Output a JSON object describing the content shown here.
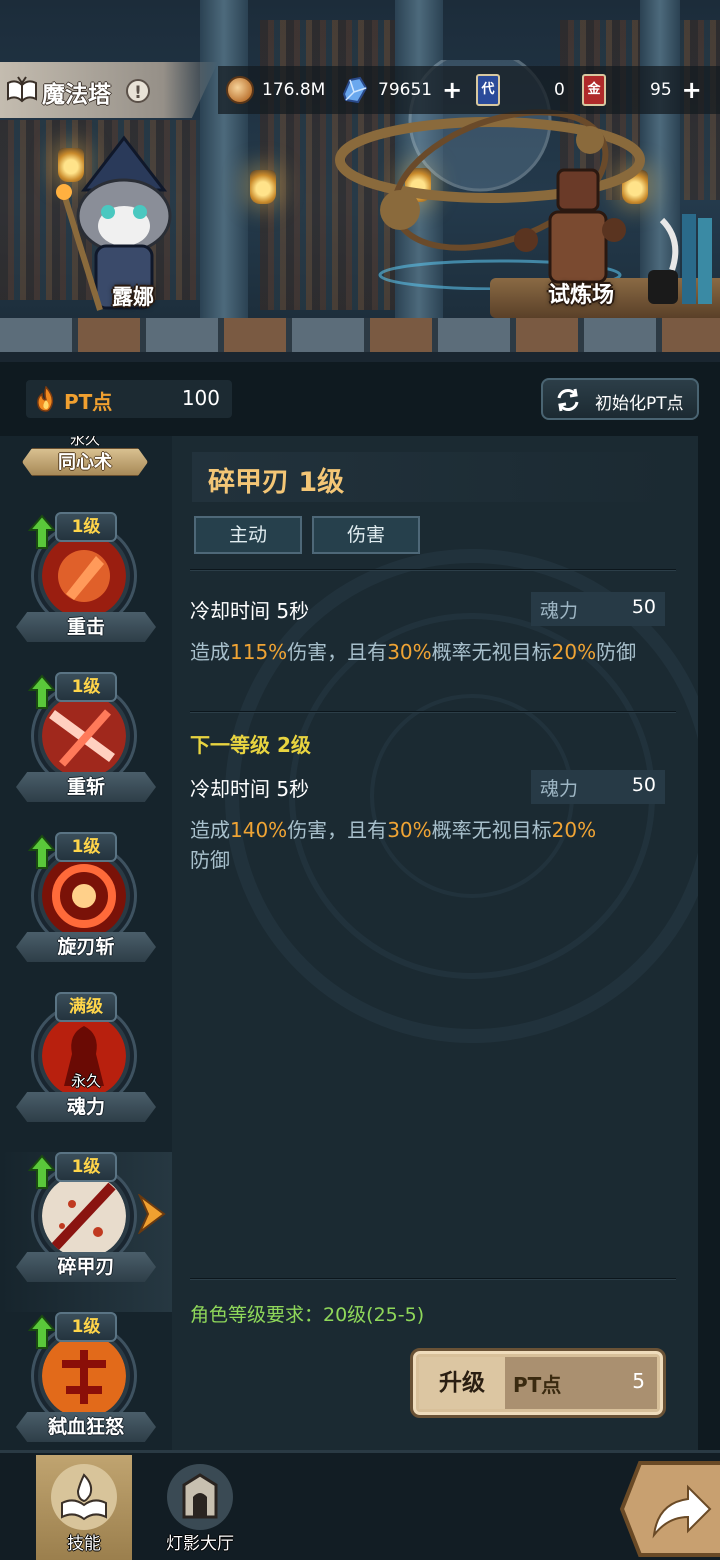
{
  "header": {
    "title": "魔法塔",
    "info_glyph": "!",
    "resources": [
      {
        "name": "gold-coin",
        "value": "176.8M",
        "plus": false
      },
      {
        "name": "crystal",
        "value": "79651",
        "plus": true
      },
      {
        "name": "blue-card",
        "glyph": "代",
        "value": "0",
        "plus": false
      },
      {
        "name": "red-card",
        "glyph": "金",
        "value": "95",
        "plus": true
      }
    ],
    "plus_glyph": "+"
  },
  "scene": {
    "character_label": "露娜",
    "training_label": "试炼场"
  },
  "pt": {
    "label": "PT点",
    "value": "100",
    "reset_label": "初始化PT点"
  },
  "skills_list": {
    "top_tab_small": "永久",
    "top_tab_label": "同心术",
    "items": [
      {
        "name": "重击",
        "level": "1级",
        "upgradable": true,
        "permanent": ""
      },
      {
        "name": "重斩",
        "level": "1级",
        "upgradable": true,
        "permanent": ""
      },
      {
        "name": "旋刃斩",
        "level": "1级",
        "upgradable": true,
        "permanent": ""
      },
      {
        "name": "魂力",
        "level": "满级",
        "upgradable": false,
        "permanent": "永久"
      },
      {
        "name": "碎甲刃",
        "level": "1级",
        "upgradable": true,
        "permanent": "",
        "selected": true
      },
      {
        "name": "弑血狂怒",
        "level": "1级",
        "upgradable": true,
        "permanent": ""
      }
    ]
  },
  "detail": {
    "title": "碎甲刃 1级",
    "tags": [
      "主动",
      "伤害"
    ],
    "current": {
      "cooldown": "冷却时间 5秒",
      "cost_label": "魂力",
      "cost_value": "50",
      "desc_parts": {
        "a": "造成",
        "b": "115%",
        "c": "伤害，且有",
        "d": "30%",
        "e": "概率无视目标",
        "f": "20%",
        "g": "防御"
      }
    },
    "next": {
      "header": "下一等级 2级",
      "cooldown": "冷却时间 5秒",
      "cost_label": "魂力",
      "cost_value": "50",
      "desc_parts": {
        "a": "造成",
        "b": "140%",
        "c": "伤害，且有",
        "d": "30%",
        "e": "概率无视目标",
        "f": "20%",
        "g": "防御"
      }
    },
    "requirement": "角色等级要求：20级(25-5)",
    "upgrade": {
      "label": "升级",
      "cost_label": "PT点",
      "cost_value": "5"
    }
  },
  "bottom_nav": {
    "items": [
      {
        "label": "技能",
        "active": true
      },
      {
        "label": "灯影大厅",
        "active": false
      }
    ]
  },
  "colors": {
    "accent_gold": "#f4c676",
    "highlight_orange": "#f0a434",
    "level_yellow": "#ffd54a",
    "requirement_green": "#8fd85a",
    "next_level_yellow": "#e8d440"
  }
}
